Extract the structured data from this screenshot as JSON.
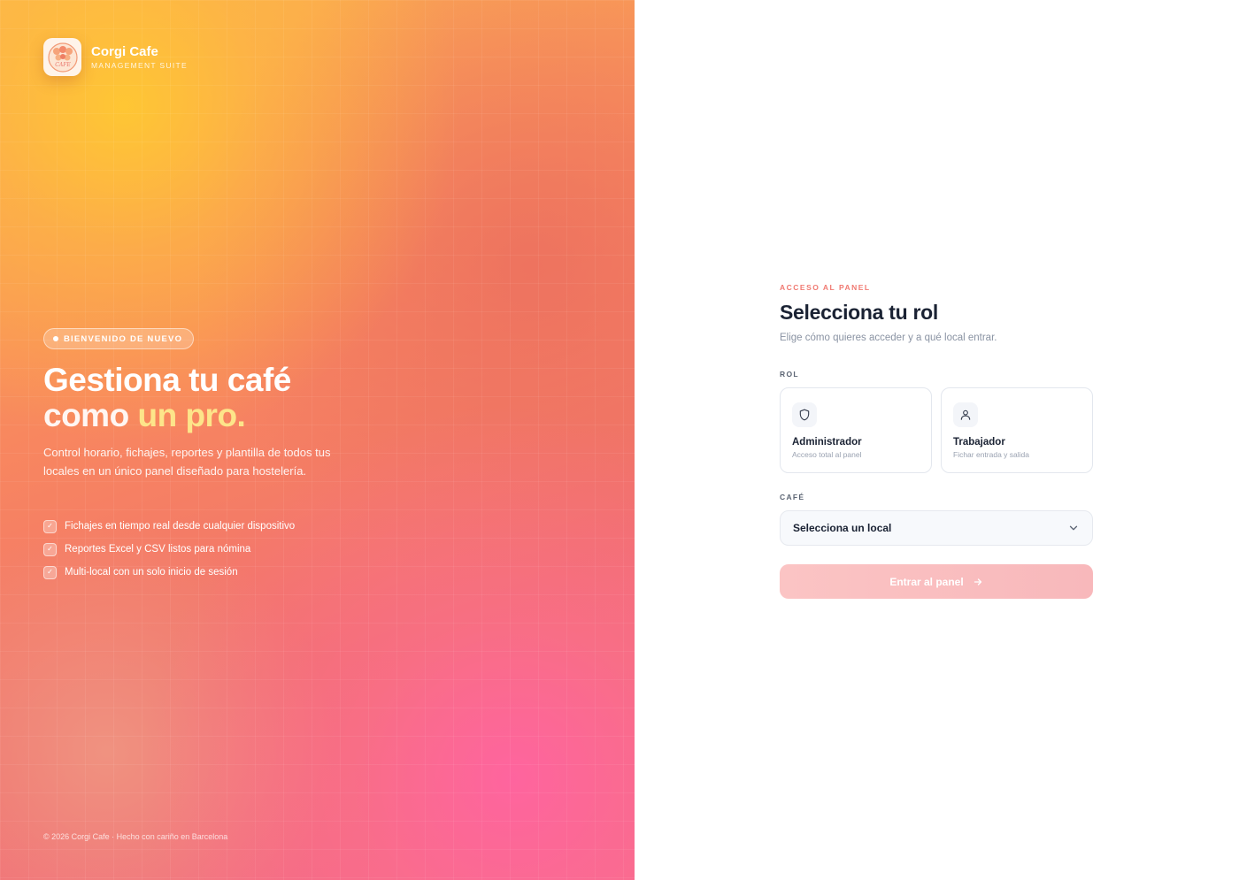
{
  "brand": {
    "name": "Corgi Cafe",
    "tagline": "MANAGEMENT SUITE",
    "logo_text": "CAFE"
  },
  "hero": {
    "badge": "BIENVENIDO DE NUEVO",
    "headline_line1": "Gestiona tu café",
    "headline_word1": "como",
    "headline_word2": "un",
    "headline_word3": "pro.",
    "lead": "Control horario, fichajes, reportes y plantilla de todos tus locales en un único panel diseñado para hostelería.",
    "features": [
      "Fichajes en tiempo real desde cualquier dispositivo",
      "Reportes Excel y CSV listos para nómina",
      "Multi-local con un solo inicio de sesión"
    ],
    "footer": "© 2026 Corgi Cafe · Hecho con cariño en Barcelona"
  },
  "form": {
    "eyebrow": "ACCESO AL PANEL",
    "title": "Selecciona tu rol",
    "subtitle": "Elige cómo quieres acceder y a qué local entrar.",
    "role_label": "ROL",
    "roles": [
      {
        "name": "Administrador",
        "description": "Acceso total al panel",
        "icon": "shield-icon"
      },
      {
        "name": "Trabajador",
        "description": "Fichar entrada y salida",
        "icon": "user-icon"
      }
    ],
    "cafe_label": "CAFÉ",
    "cafe_select_value": "Selecciona un local",
    "submit_label": "Entrar al panel"
  },
  "colors": {
    "accent": "#f07a72",
    "headline_highlight": "#fde58a",
    "text_dark": "#1a2233",
    "submit_disabled": "#fbc4c4"
  }
}
